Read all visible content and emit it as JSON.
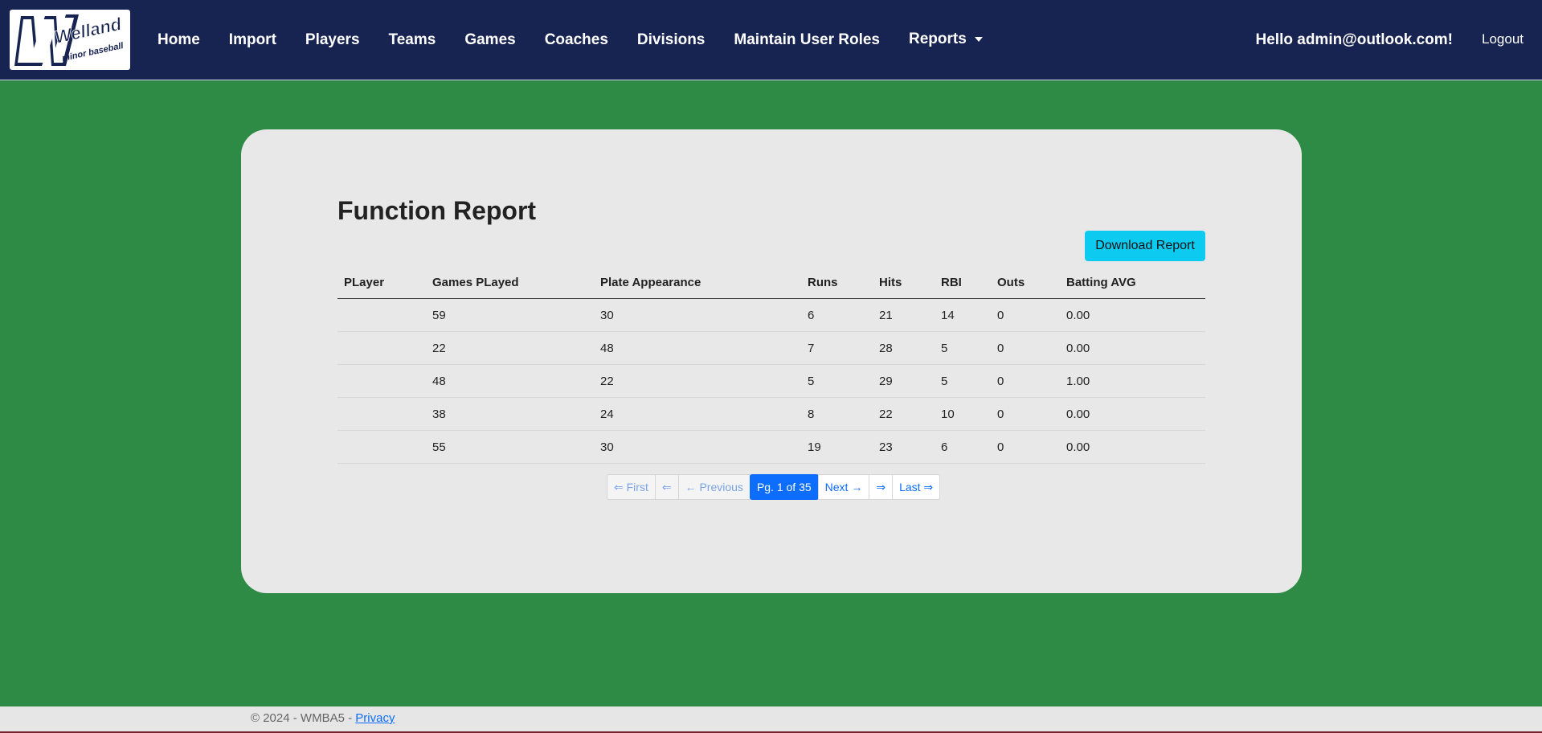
{
  "brand": {
    "logo_main": "Welland",
    "logo_sub": "minor baseball"
  },
  "nav": {
    "items": [
      {
        "label": "Home"
      },
      {
        "label": "Import"
      },
      {
        "label": "Players"
      },
      {
        "label": "Teams"
      },
      {
        "label": "Games"
      },
      {
        "label": "Coaches"
      },
      {
        "label": "Divisions"
      },
      {
        "label": "Maintain User Roles"
      }
    ],
    "reports_label": "Reports",
    "greeting": "Hello admin@outlook.com!",
    "logout_label": "Logout"
  },
  "page": {
    "title": "Function Report",
    "download_label": "Download Report"
  },
  "table": {
    "headers": [
      "PLayer",
      "Games PLayed",
      "Plate Appearance",
      "Runs",
      "Hits",
      "RBI",
      "Outs",
      "Batting AVG"
    ],
    "rows": [
      [
        "",
        "59",
        "30",
        "6",
        "21",
        "14",
        "0",
        "0.00"
      ],
      [
        "",
        "22",
        "48",
        "7",
        "28",
        "5",
        "0",
        "0.00"
      ],
      [
        "",
        "48",
        "22",
        "5",
        "29",
        "5",
        "0",
        "1.00"
      ],
      [
        "",
        "38",
        "24",
        "8",
        "22",
        "10",
        "0",
        "0.00"
      ],
      [
        "",
        "55",
        "30",
        "19",
        "23",
        "6",
        "0",
        "0.00"
      ]
    ]
  },
  "pager": {
    "first": "⇐ First",
    "prev_arrow": "⇐",
    "previous": "← Previous",
    "current": "Pg. 1 of 35",
    "next": "Next →",
    "next_arrow": "⇒",
    "last": "Last ⇒"
  },
  "footer": {
    "copyright": "© 2024 - WMBA5 - ",
    "privacy_label": "Privacy"
  },
  "colors": {
    "navbar": "#172350",
    "background": "#2e8b45",
    "accent": "#0dcaf0",
    "link": "#0d6efd"
  }
}
